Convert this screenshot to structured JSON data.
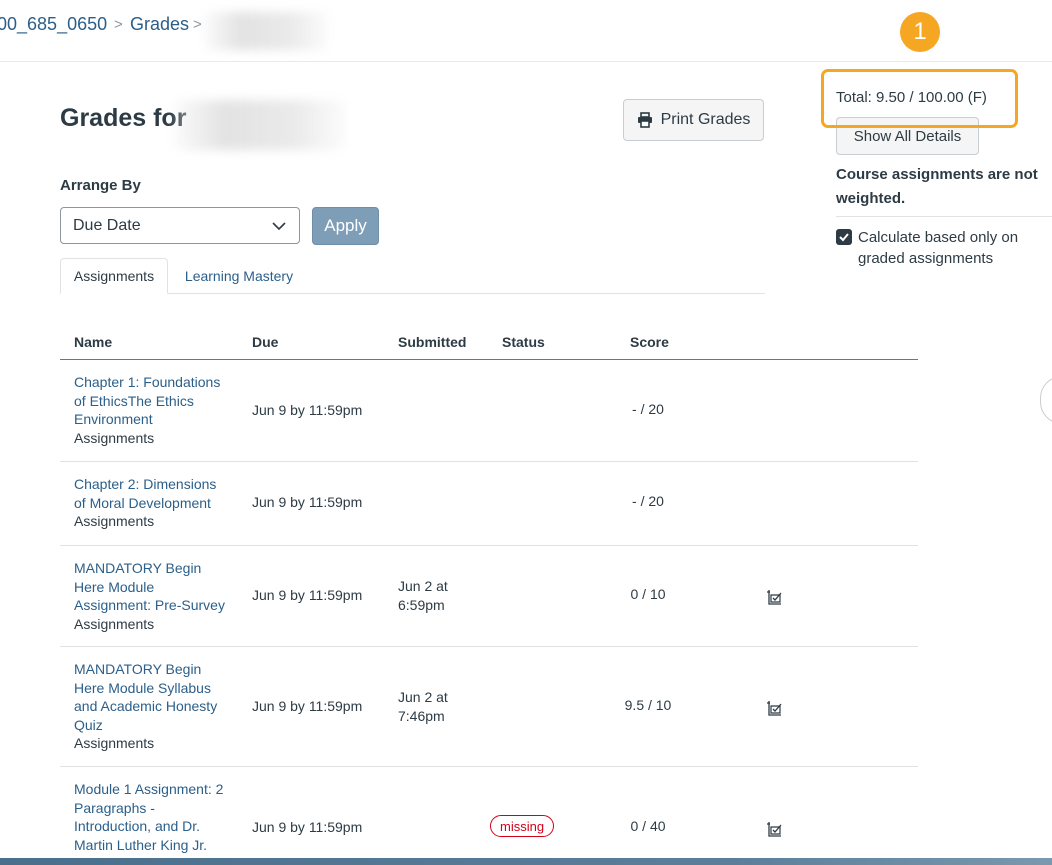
{
  "breadcrumb": {
    "course": "00_685_0650",
    "separator": ">",
    "current": "Grades"
  },
  "page": {
    "title": "Grades for",
    "print_label": "Print Grades"
  },
  "arrange": {
    "label": "Arrange By",
    "selected": "Due Date",
    "apply_label": "Apply"
  },
  "tabs": [
    {
      "label": "Assignments",
      "active": true
    },
    {
      "label": "Learning Mastery",
      "active": false
    }
  ],
  "table": {
    "headers": {
      "name": "Name",
      "due": "Due",
      "submitted": "Submitted",
      "status": "Status",
      "score": "Score"
    },
    "rows": [
      {
        "name_lines": [
          "Chapter 1: Foundations",
          "of EthicsThe Ethics",
          "Environment"
        ],
        "group": "Assignments",
        "due": "Jun 9 by 11:59pm",
        "submitted_lines": [],
        "status": "",
        "score": "- / 20"
      },
      {
        "name_lines": [
          "Chapter 2: Dimensions",
          "of Moral Development"
        ],
        "group": "Assignments",
        "due": "Jun 9 by 11:59pm",
        "submitted_lines": [],
        "status": "",
        "score": "- / 20"
      },
      {
        "name_lines": [
          "MANDATORY Begin",
          "Here Module",
          "Assignment: Pre-Survey"
        ],
        "group": "Assignments",
        "due": "Jun 9 by 11:59pm",
        "submitted_lines": [
          "Jun 2 at",
          "6:59pm"
        ],
        "status": "",
        "score": "0 / 10"
      },
      {
        "name_lines": [
          "MANDATORY Begin",
          "Here Module Syllabus",
          "and Academic Honesty",
          "Quiz"
        ],
        "group": "Assignments",
        "due": "Jun 9 by 11:59pm",
        "submitted_lines": [
          "Jun 2 at",
          "7:46pm"
        ],
        "status": "",
        "score": "9.5 / 10"
      },
      {
        "name_lines": [
          "Module 1 Assignment: 2",
          "Paragraphs -",
          "Introduction, and Dr.",
          "Martin Luther King Jr."
        ],
        "group": "Assignments",
        "due": "Jun 9 by 11:59pm",
        "submitted_lines": [],
        "status": "missing",
        "score": "0 / 40"
      }
    ]
  },
  "sidebar": {
    "marker": "1",
    "total": "Total: 9.50 / 100.00 (F)",
    "show_all_label": "Show All Details",
    "weight_note": "Course assignments are not weighted.",
    "calc_label": "Calculate based only on graded assignments",
    "calc_checked": true
  },
  "colors": {
    "link": "#2b5f8a",
    "highlight": "#f5a623",
    "missing": "#d0021b",
    "apply_button": "#7e9db6"
  }
}
